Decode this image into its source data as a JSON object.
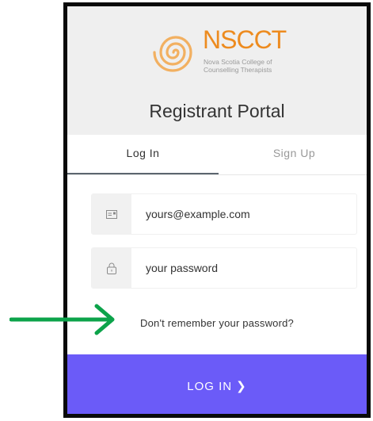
{
  "logo": {
    "acronym": "NSCCT",
    "line1": "Nova Scotia College of",
    "line2": "Counselling Therapists",
    "brand_color": "#ed8b1f"
  },
  "portal": {
    "title": "Registrant Portal"
  },
  "tabs": [
    {
      "label": "Log In",
      "active": true
    },
    {
      "label": "Sign Up",
      "active": false
    }
  ],
  "email": {
    "placeholder": "yours@example.com",
    "icon": "envelope-icon"
  },
  "password": {
    "placeholder": "your password",
    "icon": "lock-icon"
  },
  "forgot": {
    "label": "Don't remember your password?"
  },
  "submit": {
    "label": "LOG IN",
    "chevron": "❯",
    "color": "#6b5bf8"
  },
  "annotation": {
    "icon": "green-arrow-icon",
    "color": "#0ca34a"
  }
}
